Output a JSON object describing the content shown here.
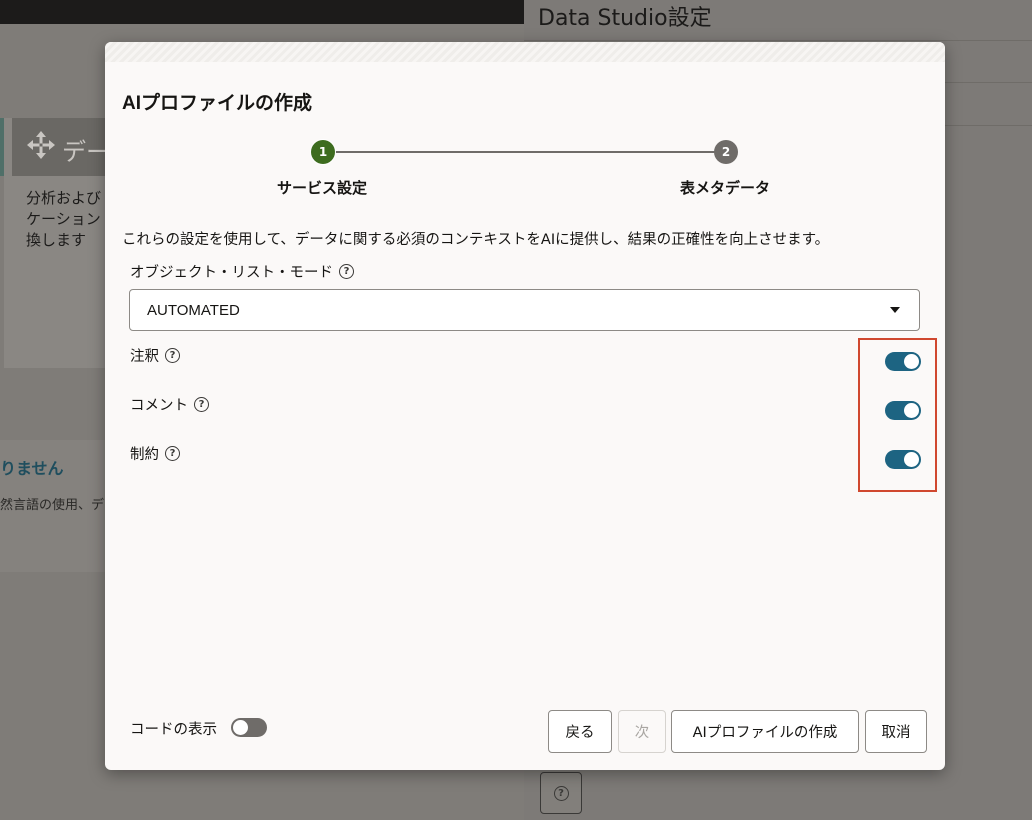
{
  "background": {
    "card_title": "デー",
    "card_text": "分析および\nケーション\n換します",
    "banner_title": "りません",
    "banner_text": "然言語の使用、デー",
    "settings_title": "Data Studio設定"
  },
  "dialog": {
    "title": "AIプロファイルの作成",
    "steps": [
      {
        "number": "1",
        "label": "サービス設定",
        "status": "current"
      },
      {
        "number": "2",
        "label": "表メタデータ",
        "status": "pending"
      }
    ],
    "description": "これらの設定を使用して、データに関する必須のコンテキストをAIに提供し、結果の正確性を向上させます。",
    "object_list_mode": {
      "label": "オブジェクト・リスト・モード",
      "value": "AUTOMATED"
    },
    "toggles": [
      {
        "label": "注釈",
        "on": true
      },
      {
        "label": "コメント",
        "on": true
      },
      {
        "label": "制約",
        "on": true
      }
    ],
    "show_code": {
      "label": "コードの表示",
      "on": false
    },
    "buttons": {
      "back": "戻る",
      "next": "次",
      "create": "AIプロファイルの作成",
      "cancel": "取消"
    }
  },
  "colors": {
    "accent_toggle": "#1d6482",
    "step_current": "#3d6c1f",
    "highlight": "#d0482f"
  },
  "icons": {
    "help": "question-circle-icon",
    "move": "move-arrows-icon",
    "dropdown": "caret-down-icon"
  }
}
